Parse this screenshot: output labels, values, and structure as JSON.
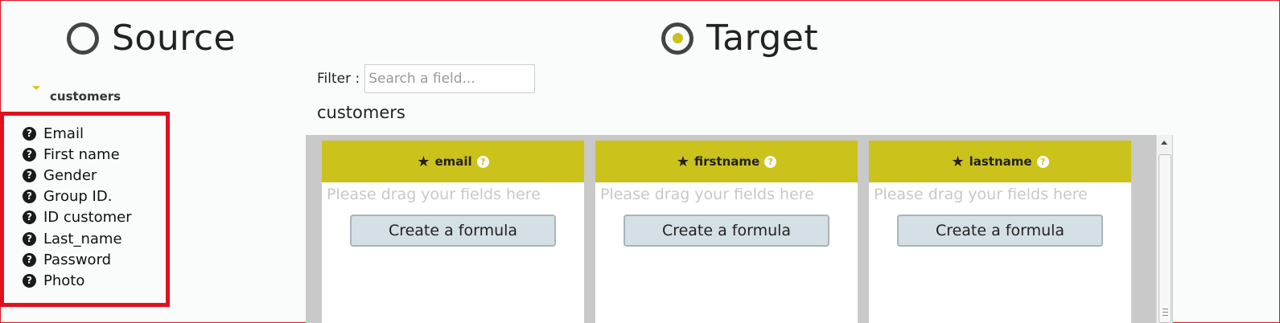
{
  "source": {
    "title": "Source"
  },
  "target": {
    "title": "Target"
  },
  "tree": {
    "root": "customers",
    "fields": [
      "Email",
      "First name",
      "Gender",
      "Group ID.",
      "ID customer",
      "Last_name",
      "Password",
      "Photo"
    ]
  },
  "filter": {
    "label": "Filter :",
    "placeholder": "Search a field..."
  },
  "table": {
    "title": "customers",
    "columns": [
      {
        "name": "email",
        "hint": "Please drag your fields here",
        "button": "Create a formula"
      },
      {
        "name": "firstname",
        "hint": "Please drag your fields here",
        "button": "Create a formula"
      },
      {
        "name": "lastname",
        "hint": "Please drag your fields here",
        "button": "Create a formula"
      }
    ]
  },
  "icons": {
    "field": "question-circle-icon",
    "required": "star-icon",
    "selected": "radio-selected-icon"
  },
  "colors": {
    "accent": "#cbc21b",
    "highlight_border": "#e1101e",
    "panel": "#c9c9c9",
    "button_bg": "#d5dfe6"
  }
}
